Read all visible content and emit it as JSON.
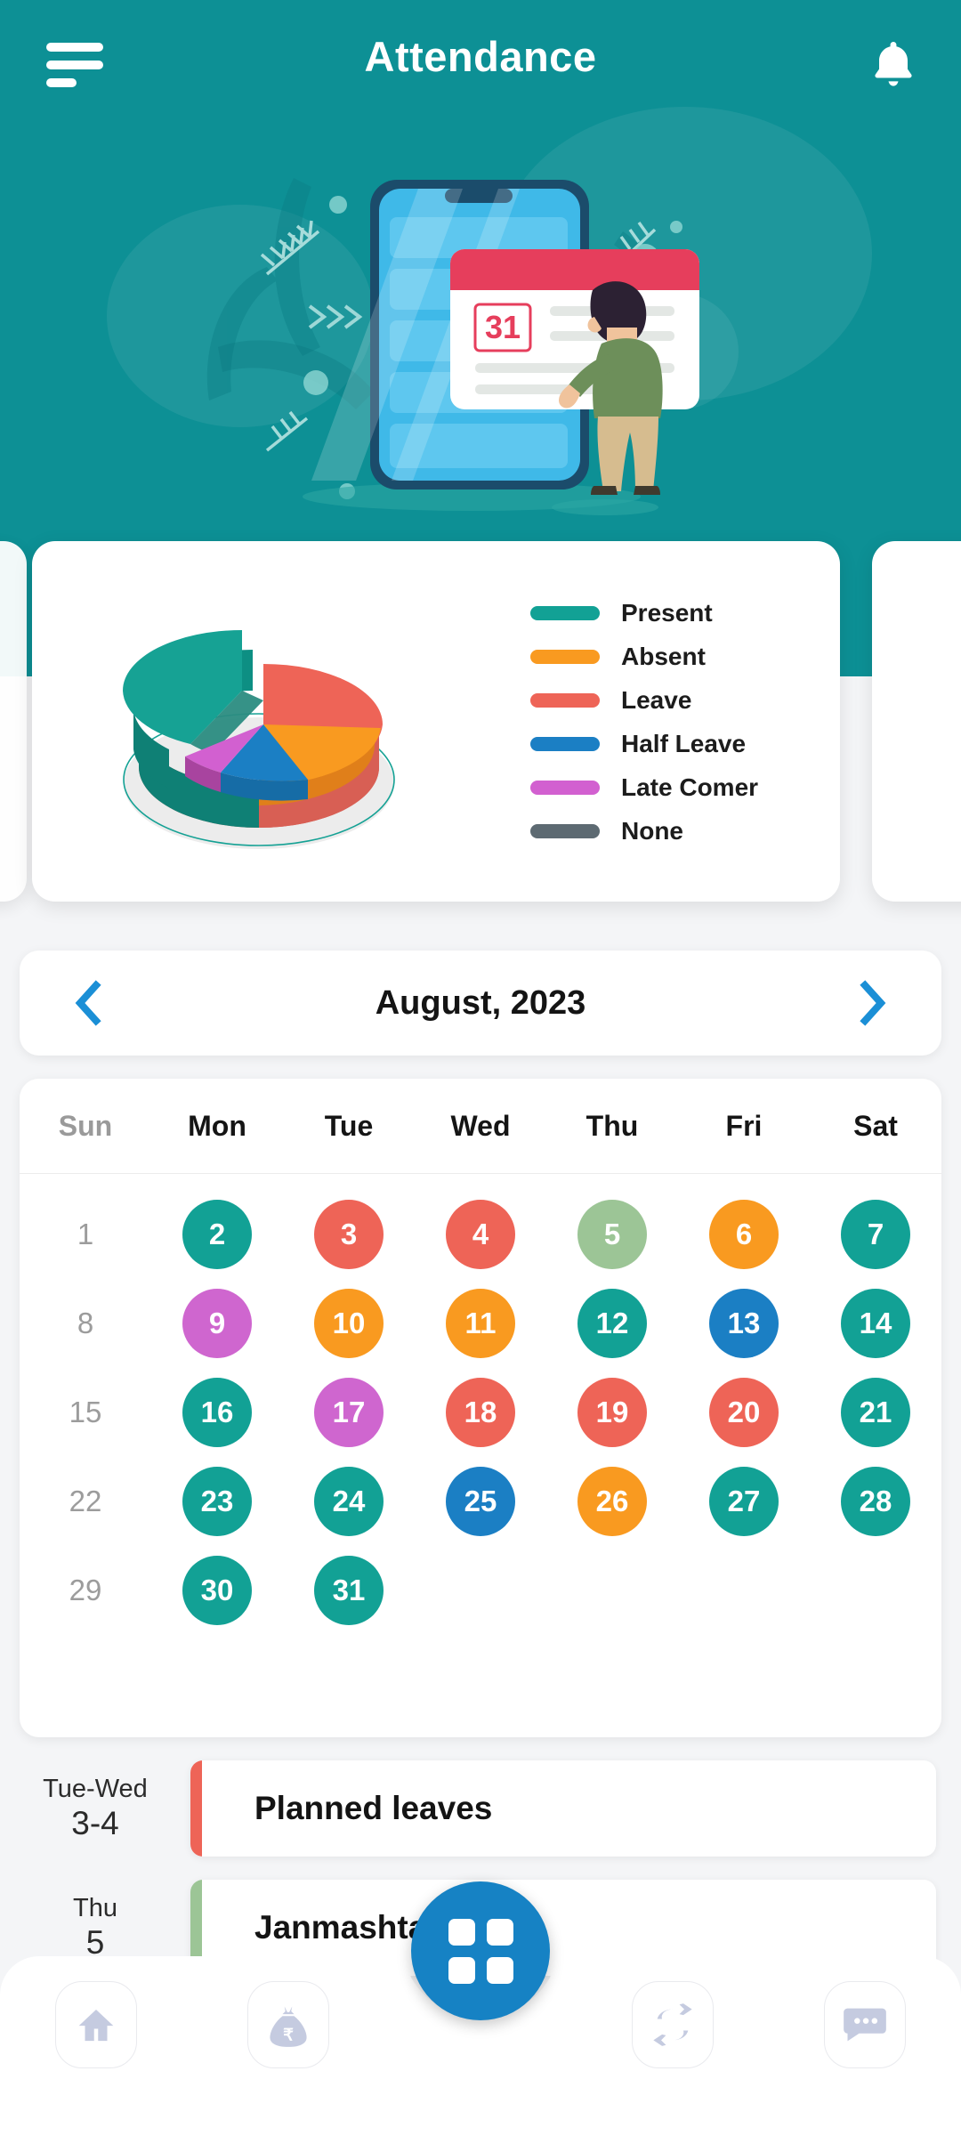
{
  "header": {
    "title": "Attendance",
    "menu_icon": "hamburger-menu-icon",
    "bell_icon": "notification-bell-icon",
    "bg_color": "#0d9095"
  },
  "hero": {
    "illustration": "person-marking-calendar-on-phone-illustration",
    "calendar_day": "31"
  },
  "chart_data": {
    "type": "pie",
    "title": "",
    "style": "3d-exploded-donut",
    "categories": [
      "Present",
      "Absent",
      "Leave",
      "Half Leave",
      "Late Comer",
      "None"
    ],
    "values": [
      38,
      17,
      25,
      12,
      8,
      0
    ],
    "colors": [
      "#12a195",
      "#f99a20",
      "#ee6457",
      "#1b7fc4",
      "#d260d0",
      "#5d6a72"
    ],
    "legend": [
      {
        "label": "Present",
        "color": "#12a195"
      },
      {
        "label": "Absent",
        "color": "#f99a20"
      },
      {
        "label": "Leave",
        "color": "#ee6457"
      },
      {
        "label": "Half Leave",
        "color": "#1b7fc4"
      },
      {
        "label": "Late Comer",
        "color": "#d260d0"
      },
      {
        "label": "None",
        "color": "#5d6a72"
      }
    ],
    "legend_position": "right",
    "grid": false
  },
  "month_nav": {
    "prev_icon": "chevron-left-icon",
    "next_icon": "chevron-right-icon",
    "label": "August, 2023",
    "arrow_color": "#1b8fd6"
  },
  "calendar": {
    "weekdays": [
      {
        "label": "Sun",
        "dim": true
      },
      {
        "label": "Mon",
        "dim": false
      },
      {
        "label": "Tue",
        "dim": false
      },
      {
        "label": "Wed",
        "dim": false
      },
      {
        "label": "Thu",
        "dim": false
      },
      {
        "label": "Fri",
        "dim": false
      },
      {
        "label": "Sat",
        "dim": false
      }
    ],
    "weeks": [
      [
        {
          "day": "1",
          "status": "none",
          "color": ""
        },
        {
          "day": "2",
          "status": "present",
          "color": "#12a195"
        },
        {
          "day": "3",
          "status": "leave",
          "color": "#ee6457"
        },
        {
          "day": "4",
          "status": "leave",
          "color": "#ee6457"
        },
        {
          "day": "5",
          "status": "holiday",
          "color": "#9cc596"
        },
        {
          "day": "6",
          "status": "absent",
          "color": "#f99a20"
        },
        {
          "day": "7",
          "status": "present",
          "color": "#12a195"
        }
      ],
      [
        {
          "day": "8",
          "status": "none",
          "color": ""
        },
        {
          "day": "9",
          "status": "late-comer",
          "color": "#cf66cf"
        },
        {
          "day": "10",
          "status": "absent",
          "color": "#f99a20"
        },
        {
          "day": "11",
          "status": "absent",
          "color": "#f99a20"
        },
        {
          "day": "12",
          "status": "present",
          "color": "#12a195"
        },
        {
          "day": "13",
          "status": "half-leave",
          "color": "#1b7fc4"
        },
        {
          "day": "14",
          "status": "present",
          "color": "#12a195"
        }
      ],
      [
        {
          "day": "15",
          "status": "none",
          "color": ""
        },
        {
          "day": "16",
          "status": "present",
          "color": "#12a195"
        },
        {
          "day": "17",
          "status": "late-comer",
          "color": "#cf66cf"
        },
        {
          "day": "18",
          "status": "leave",
          "color": "#ee6457"
        },
        {
          "day": "19",
          "status": "leave",
          "color": "#ee6457"
        },
        {
          "day": "20",
          "status": "leave",
          "color": "#ee6457"
        },
        {
          "day": "21",
          "status": "present",
          "color": "#12a195"
        }
      ],
      [
        {
          "day": "22",
          "status": "none",
          "color": ""
        },
        {
          "day": "23",
          "status": "present",
          "color": "#12a195"
        },
        {
          "day": "24",
          "status": "present",
          "color": "#12a195"
        },
        {
          "day": "25",
          "status": "half-leave",
          "color": "#1b7fc4"
        },
        {
          "day": "26",
          "status": "absent",
          "color": "#f99a20"
        },
        {
          "day": "27",
          "status": "present",
          "color": "#12a195"
        },
        {
          "day": "28",
          "status": "present",
          "color": "#12a195"
        }
      ],
      [
        {
          "day": "29",
          "status": "none",
          "color": ""
        },
        {
          "day": "30",
          "status": "present",
          "color": "#12a195"
        },
        {
          "day": "31",
          "status": "present",
          "color": "#12a195"
        },
        {
          "day": "",
          "status": "empty",
          "color": ""
        },
        {
          "day": "",
          "status": "empty",
          "color": ""
        },
        {
          "day": "",
          "status": "empty",
          "color": ""
        },
        {
          "day": "",
          "status": "empty",
          "color": ""
        }
      ]
    ]
  },
  "events": [
    {
      "dow": "Tue-Wed",
      "num": "3-4",
      "title": "Planned leaves",
      "accent": "#ee6457"
    },
    {
      "dow": "Thu",
      "num": "5",
      "title": "Janmashtami",
      "accent": "#9cc596"
    }
  ],
  "bottom_nav": {
    "items": [
      {
        "icon": "home-icon"
      },
      {
        "icon": "money-bag-rupee-icon"
      },
      {
        "icon": "sync-refresh-icon"
      },
      {
        "icon": "chat-bubble-icon"
      }
    ],
    "fab": {
      "icon": "grid-apps-icon",
      "color": "#1682c4"
    }
  }
}
